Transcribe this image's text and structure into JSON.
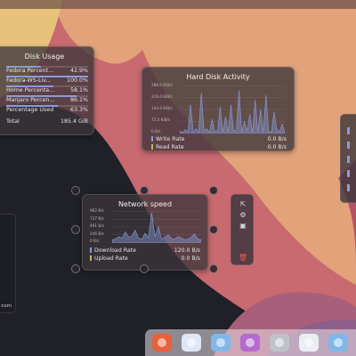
{
  "colors": {
    "accent": "#8a9ad8",
    "accent2": "#c9b26a",
    "widget_bg": "#3c343a",
    "wallpaper_dark": "#1f2028",
    "wallpaper_peach": "#e3a37a",
    "wallpaper_pink": "#c86a70"
  },
  "disk_usage": {
    "title": "Disk Usage",
    "rows": [
      {
        "label": "Fedora Percent...",
        "value": "42.9%",
        "fraction": 0.429
      },
      {
        "label": "Fedora-WS-Liv...",
        "value": "100.0%",
        "fraction": 1.0
      },
      {
        "label": "Home Percenta...",
        "value": "58.1%",
        "fraction": 0.581
      },
      {
        "label": "Manjaro Percen...",
        "value": "86.1%",
        "fraction": 0.861
      },
      {
        "label": "Percentage Used",
        "value": "63.3%",
        "fraction": 0.633
      }
    ],
    "total_label": "Total",
    "total_value": "185.4 GiB"
  },
  "hard_disk_activity": {
    "title": "Hard Disk Activity",
    "ticks": [
      "288.0 KiB/s",
      "216.0 KiB/s",
      "144.0 KiB/s",
      "72.0 KiB/s",
      "0 B/s"
    ],
    "legend": [
      {
        "label": "Write Rate",
        "value": "0.0 B/s",
        "color": "#8a9ad8"
      },
      {
        "label": "Read Rate",
        "value": "0.0 B/s",
        "color": "#c9b26a"
      }
    ],
    "series": [
      0.05,
      0.02,
      0.08,
      0.03,
      0.6,
      0.04,
      0.1,
      0.02,
      0.85,
      0.05,
      0.1,
      0.02,
      0.3,
      0.04,
      0.05,
      0.55,
      0.02,
      0.35,
      0.03,
      0.6,
      0.05,
      0.08,
      0.9,
      0.03,
      0.25,
      0.05,
      0.4,
      0.02,
      0.7,
      0.04,
      0.5,
      0.03,
      0.8,
      0.05,
      0.02,
      0.45,
      0.1,
      0.03,
      0.2,
      0.02
    ]
  },
  "network_speed": {
    "title": "Network speed",
    "ticks": [
      "982 B/s",
      "737 B/s",
      "491 B/s",
      "246 B/s",
      "0 B/s"
    ],
    "legend": [
      {
        "label": "Download Rate",
        "value": "120.0 B/s",
        "color": "#8a9ad8"
      },
      {
        "label": "Upload Rate",
        "value": "0.0 B/s",
        "color": "#c9b26a"
      }
    ],
    "series": [
      0.1,
      0.12,
      0.2,
      0.15,
      0.35,
      0.18,
      0.22,
      0.4,
      0.15,
      0.12,
      0.3,
      0.16,
      0.95,
      0.2,
      0.5,
      0.12,
      0.18,
      0.25,
      0.14,
      0.12,
      0.2,
      0.15,
      0.1,
      0.12,
      0.18,
      0.28,
      0.12,
      0.1
    ]
  },
  "toolbar": {
    "icons": [
      "pin-icon",
      "settings-icon",
      "screen-icon",
      "trash-icon"
    ]
  },
  "left_partial": {
    "text": "com"
  },
  "dock": {
    "icons": [
      {
        "name": "firefox-icon",
        "bg": "#e8603c"
      },
      {
        "name": "browser-icon",
        "bg": "#dfe6f5"
      },
      {
        "name": "folder-icon",
        "bg": "#7fb8e8"
      },
      {
        "name": "store-icon",
        "bg": "#b56ad0"
      },
      {
        "name": "settings-icon",
        "bg": "#bfc3c9"
      },
      {
        "name": "monitor-icon",
        "bg": "#e9eef2"
      },
      {
        "name": "files-icon",
        "bg": "#7fb8e8"
      }
    ]
  }
}
